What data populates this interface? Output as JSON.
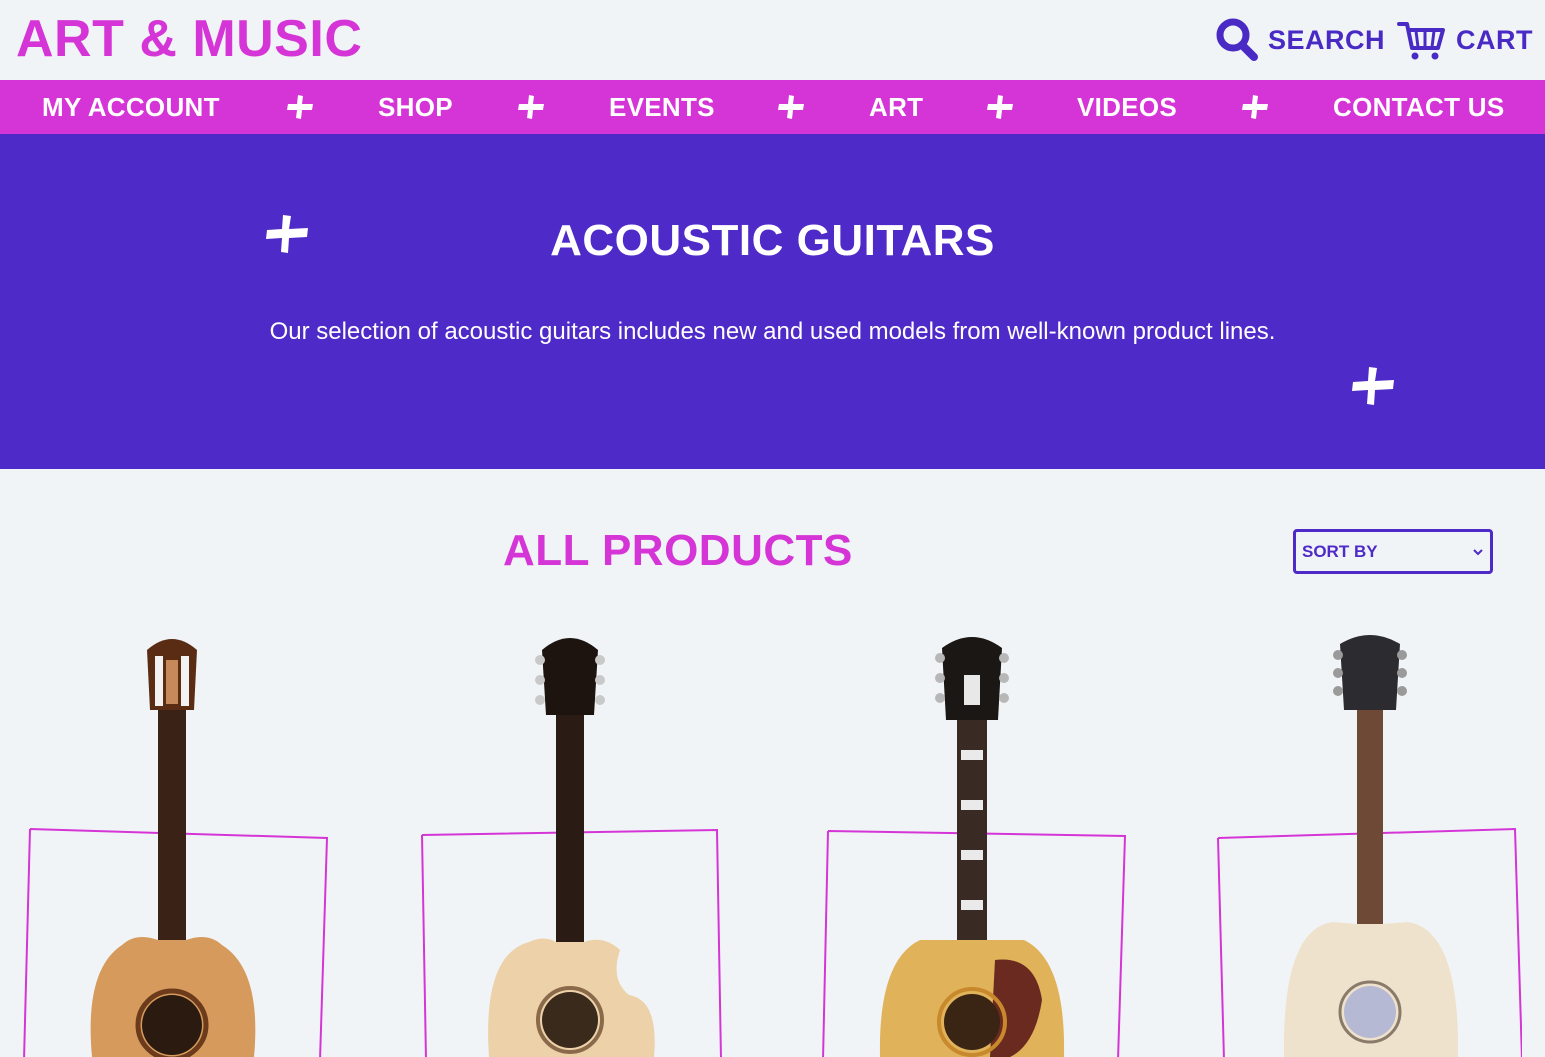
{
  "brand": {
    "logo": "ART & MUSIC"
  },
  "header": {
    "search_label": "SEARCH",
    "cart_label": "CART"
  },
  "nav": {
    "items": [
      {
        "label": "MY ACCOUNT"
      },
      {
        "label": "SHOP"
      },
      {
        "label": "EVENTS"
      },
      {
        "label": "ART"
      },
      {
        "label": "VIDEOS"
      },
      {
        "label": "CONTACT US"
      }
    ]
  },
  "hero": {
    "title": "ACOUSTIC GUITARS",
    "description": "Our selection of acoustic guitars includes new and used models from well-known product lines."
  },
  "products_section": {
    "title": "ALL PRODUCTS",
    "sort_label": "SORT BY"
  },
  "products": [
    {
      "image": "classical-guitar"
    },
    {
      "image": "taylor-cutaway-guitar"
    },
    {
      "image": "gibson-dove-guitar"
    },
    {
      "image": "nashville-dreadnought-guitar"
    }
  ],
  "colors": {
    "magenta": "#d535d6",
    "purple": "#4e2ac8",
    "background": "#f1f4f7",
    "white": "#ffffff"
  },
  "icons": [
    "search-icon",
    "cart-icon",
    "plus-icon",
    "chevron-down-icon"
  ]
}
